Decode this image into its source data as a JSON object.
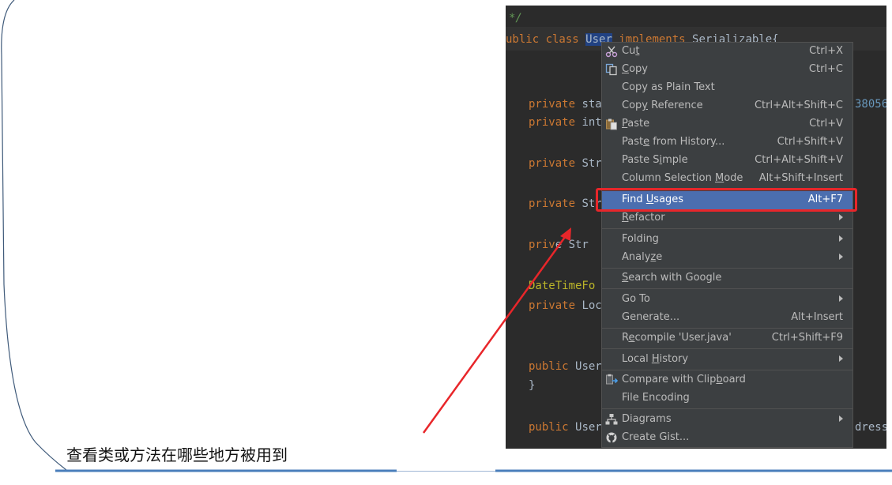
{
  "editor": {
    "comment": "*/",
    "class_line": {
      "kw1": "ublic class ",
      "cls": "User",
      "kw2": " implements ",
      "iface": "Serializable{"
    },
    "fields": [
      {
        "kw": "private ",
        "text": "sta"
      },
      {
        "kw": "private ",
        "text": "int"
      },
      {
        "kw": "private ",
        "text": "Str"
      },
      {
        "kw": "private ",
        "text": "Str"
      },
      {
        "kw": "priv",
        "text": "e Str"
      }
    ],
    "serial_fragment": "38056",
    "annotation": "DateTimeFo",
    "private_loc": {
      "kw": "private ",
      "text": "Loc"
    },
    "public_user1": {
      "kw": "public ",
      "text": "User"
    },
    "brace": "}",
    "public_user2": {
      "kw": "public ",
      "text": "User"
    },
    "address_fragment": "dress"
  },
  "menu": {
    "cut": {
      "pre": "Cu",
      "u": "t",
      "post": "",
      "shortcut": "Ctrl+X"
    },
    "copy": {
      "pre": "",
      "u": "C",
      "post": "opy",
      "shortcut": "Ctrl+C"
    },
    "copy_plain": {
      "pre": "Copy as Plain Text",
      "u": "",
      "post": "",
      "shortcut": ""
    },
    "copy_reference": {
      "pre": "Cop",
      "u": "y",
      "post": " Reference",
      "shortcut": "Ctrl+Alt+Shift+C"
    },
    "paste": {
      "pre": "",
      "u": "P",
      "post": "aste",
      "shortcut": "Ctrl+V"
    },
    "paste_history": {
      "pre": "Past",
      "u": "e",
      "post": " from History...",
      "shortcut": "Ctrl+Shift+V"
    },
    "paste_simple": {
      "pre": "Paste S",
      "u": "i",
      "post": "mple",
      "shortcut": "Ctrl+Alt+Shift+V"
    },
    "column_selection": {
      "pre": "Column Selection ",
      "u": "M",
      "post": "ode",
      "shortcut": "Alt+Shift+Insert"
    },
    "find_usages": {
      "pre": "Find ",
      "u": "U",
      "post": "sages",
      "shortcut": "Alt+F7"
    },
    "refactor": {
      "pre": "",
      "u": "R",
      "post": "efactor",
      "shortcut": ""
    },
    "folding": {
      "pre": "Folding",
      "u": "",
      "post": "",
      "shortcut": ""
    },
    "analyze": {
      "pre": "Analy",
      "u": "z",
      "post": "e",
      "shortcut": ""
    },
    "search_google": {
      "pre": "",
      "u": "S",
      "post": "earch with Google",
      "shortcut": ""
    },
    "go_to": {
      "pre": "Go To",
      "u": "",
      "post": "",
      "shortcut": ""
    },
    "generate": {
      "pre": "Generate...",
      "u": "",
      "post": "",
      "shortcut": "Alt+Insert"
    },
    "recompile": {
      "pre": "R",
      "u": "e",
      "post": "compile 'User.java'",
      "shortcut": "Ctrl+Shift+F9"
    },
    "local_history": {
      "pre": "Local ",
      "u": "H",
      "post": "istory",
      "shortcut": ""
    },
    "compare_clipboard": {
      "pre": "Compare with Clip",
      "u": "b",
      "post": "oard",
      "shortcut": ""
    },
    "file_encoding": {
      "pre": "File Encoding",
      "u": "",
      "post": "",
      "shortcut": ""
    },
    "diagrams": {
      "pre": "Diagrams",
      "u": "",
      "post": "",
      "shortcut": ""
    },
    "create_gist": {
      "pre": "Create Gist...",
      "u": "",
      "post": "",
      "shortcut": ""
    }
  },
  "caption": "查看类或方法在哪些地方被用到",
  "colors": {
    "annotation_red": "#e8262a",
    "accent_blue": "#4a7ebb",
    "selection_blue": "#4b6eaf",
    "editor_bg": "#2b2b2b",
    "menu_bg": "#3c3f41"
  }
}
